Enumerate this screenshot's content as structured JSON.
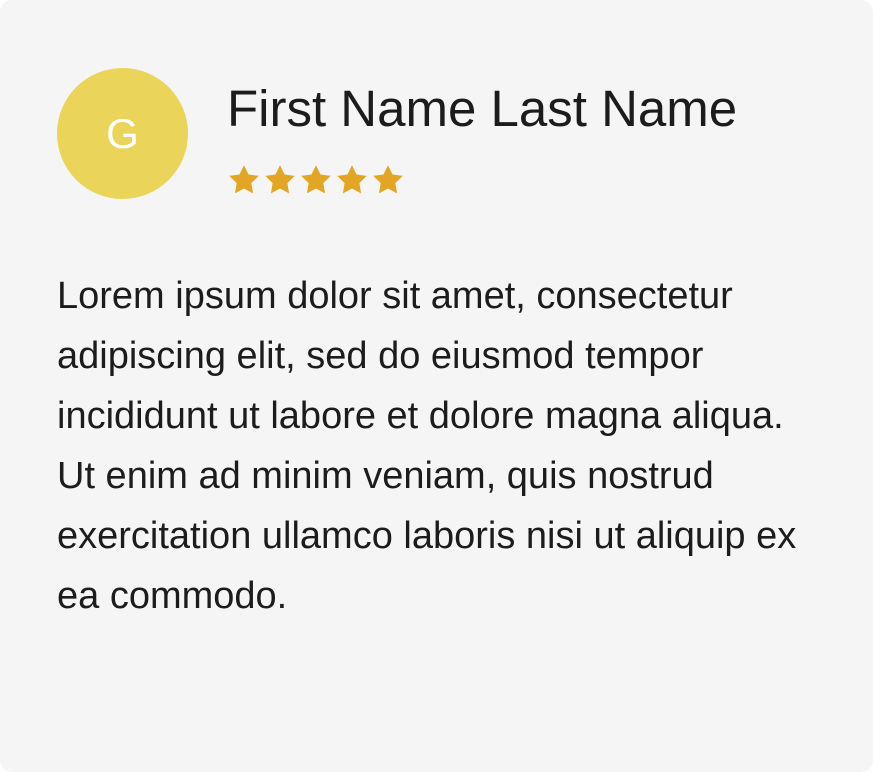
{
  "review": {
    "avatar_letter": "G",
    "name": "First Name Last Name",
    "rating": 5,
    "rating_max": 5,
    "text": "Lorem ipsum dolor sit amet, consectetur adipiscing elit, sed do eiusmod tempor incididunt ut labore et dolore magna aliqua. Ut enim ad minim veniam, quis nostrud exercitation ullamco laboris nisi ut aliquip ex ea commodo."
  },
  "colors": {
    "card_background": "#f5f5f5",
    "avatar_background": "#ead55a",
    "star": "#e2a624",
    "text": "#1c1c1c"
  },
  "icons": {
    "star": "star-icon"
  }
}
